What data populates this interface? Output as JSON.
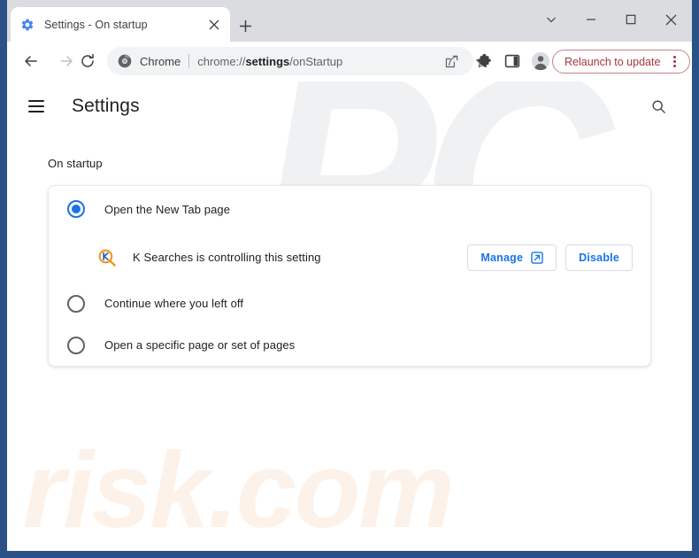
{
  "window": {
    "frame_color": "#2a5287",
    "caption_buttons": [
      {
        "name": "tab-search",
        "glyph": "chevron-down"
      },
      {
        "name": "minimize",
        "glyph": "minus"
      },
      {
        "name": "maximize",
        "glyph": "square"
      },
      {
        "name": "close",
        "glyph": "x"
      }
    ]
  },
  "tabstrip": {
    "active_tab": {
      "title": "Settings - On startup",
      "favicon": "gear-icon",
      "close_label": "×"
    },
    "new_tab_label": "+"
  },
  "toolbar": {
    "back_label": "←",
    "forward_label": "→",
    "reload_label": "↻",
    "omnibox": {
      "icon": "chrome-logo-icon",
      "scheme_label": "Chrome",
      "url_prefix": "chrome://",
      "url_bold": "settings",
      "url_suffix": "/onStartup"
    },
    "actions": [
      {
        "name": "share-icon"
      },
      {
        "name": "bookmark-star-icon"
      },
      {
        "name": "extensions-puzzle-icon"
      },
      {
        "name": "side-panel-icon"
      },
      {
        "name": "profile-avatar-icon"
      }
    ],
    "relaunch": {
      "label": "Relaunch to update",
      "text_color": "#a8353f",
      "border_color": "#c4848b",
      "menu_icon": "three-dots-vertical-icon"
    }
  },
  "settings": {
    "menu_icon": "hamburger-icon",
    "title": "Settings",
    "search_icon": "search-icon",
    "section_title": "On startup",
    "options": [
      {
        "label": "Open the New Tab page",
        "selected": true
      },
      {
        "label": "Continue where you left off",
        "selected": false
      },
      {
        "label": "Open a specific page or set of pages",
        "selected": false
      }
    ],
    "extension_notice": {
      "icon": "k-searches-magnifier-icon",
      "text": "K Searches is controlling this setting",
      "manage_label": "Manage",
      "manage_icon": "external-link-icon",
      "disable_label": "Disable",
      "accent_color": "#1a73e8"
    }
  },
  "watermark": {
    "top_text": "PC",
    "bottom_text": "risk.com"
  }
}
